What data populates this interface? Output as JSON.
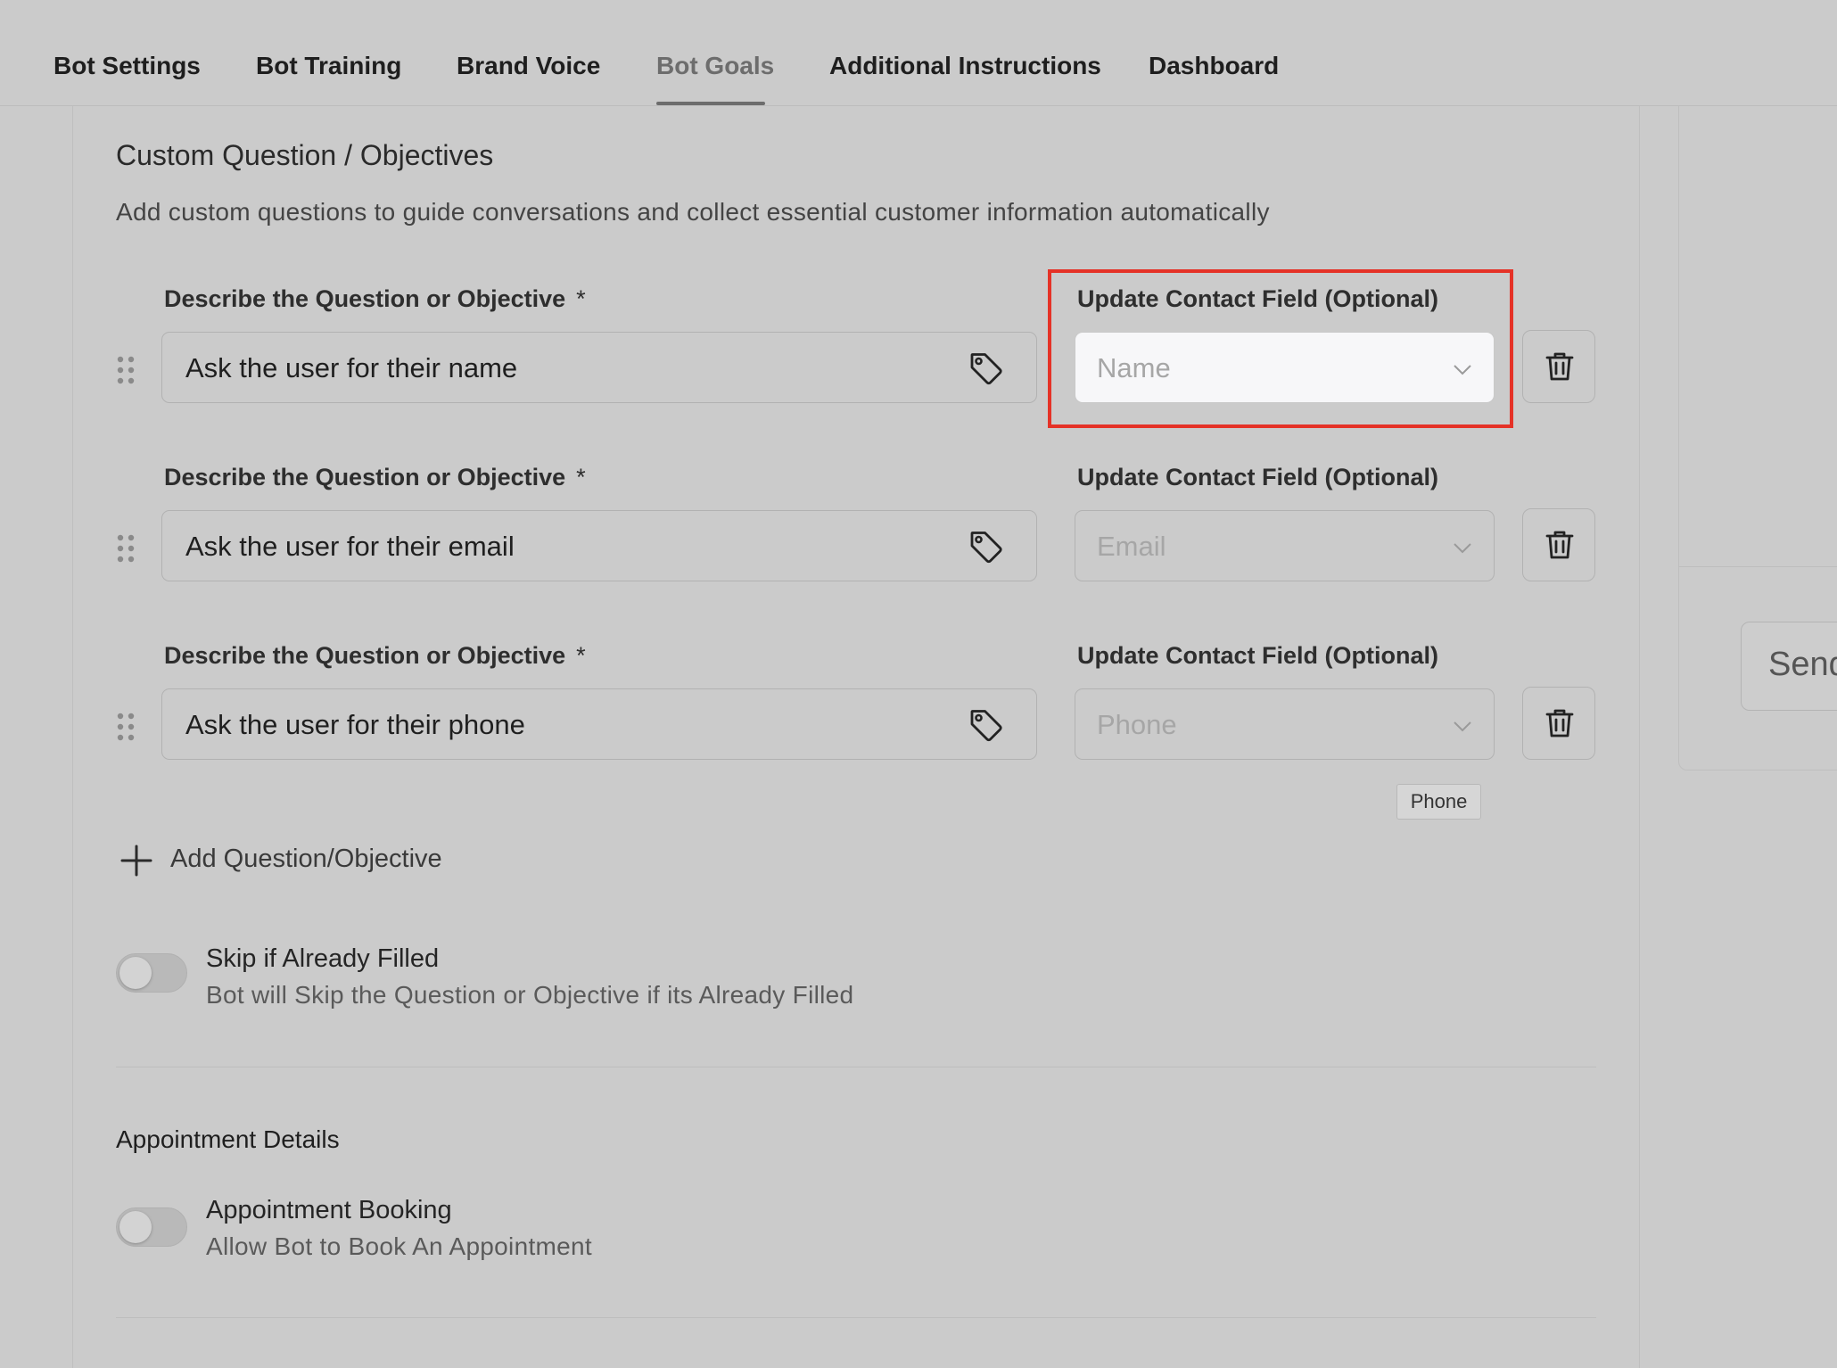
{
  "tabs": [
    {
      "label": "Bot Settings"
    },
    {
      "label": "Bot Training"
    },
    {
      "label": "Brand Voice"
    },
    {
      "label": "Bot Goals"
    },
    {
      "label": "Additional Instructions"
    },
    {
      "label": "Dashboard"
    }
  ],
  "active_tab": "Bot Goals",
  "section": {
    "title": "Custom Question / Objectives",
    "description": "Add custom questions to guide conversations and collect essential customer information automatically"
  },
  "questions": [
    {
      "label": "Describe the Question or Objective",
      "required_mark": "*",
      "value": "Ask the user for their name",
      "contact_field_label": "Update Contact Field (Optional)",
      "contact_field_placeholder": "Name"
    },
    {
      "label": "Describe the Question or Objective",
      "required_mark": "*",
      "value": "Ask the user for their email",
      "contact_field_label": "Update Contact Field (Optional)",
      "contact_field_placeholder": "Email"
    },
    {
      "label": "Describe the Question or Objective",
      "required_mark": "*",
      "value": "Ask the user for their phone",
      "contact_field_label": "Update Contact Field (Optional)",
      "contact_field_placeholder": "Phone"
    }
  ],
  "tooltip": "Phone",
  "add_question_label": "Add Question/Objective",
  "skip_toggle": {
    "title": "Skip if Already Filled",
    "description": "Bot will Skip the Question or Objective if its Already Filled",
    "enabled": false
  },
  "appointment": {
    "heading": "Appointment Details",
    "toggle_title": "Appointment Booking",
    "toggle_description": "Allow Bot to Book An Appointment",
    "enabled": false
  },
  "side_panel": {
    "button_label": "Send"
  },
  "colors": {
    "background": "#cbcbcb",
    "highlight_border": "#e53227",
    "active_tab": "#6d6d6d"
  }
}
